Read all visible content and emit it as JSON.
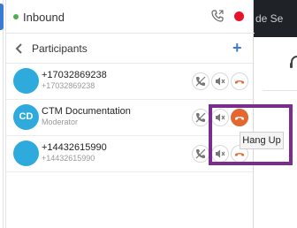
{
  "background_app": {
    "text": "de Se"
  },
  "call": {
    "title": "Inbound",
    "status_color": "#4caf50",
    "record_color": "#e8132a"
  },
  "participants_panel": {
    "title": "Participants",
    "add_label": "+"
  },
  "participants": [
    {
      "avatar": "",
      "name": "+17032869238",
      "sub": "+17032869238",
      "avatar_color": "#2eaadc"
    },
    {
      "avatar": "CD",
      "name": "CTM Documentation",
      "sub": "Moderator",
      "avatar_color": "#2eaadc"
    },
    {
      "avatar": "",
      "name": "+14432615990",
      "sub": "+14432615990",
      "avatar_color": "#2eaadc"
    }
  ],
  "tooltip": {
    "text": "Hang Up"
  },
  "colors": {
    "accent": "#3a7bd5",
    "hangup": "#e4672f",
    "highlight": "#7b2c8f"
  }
}
